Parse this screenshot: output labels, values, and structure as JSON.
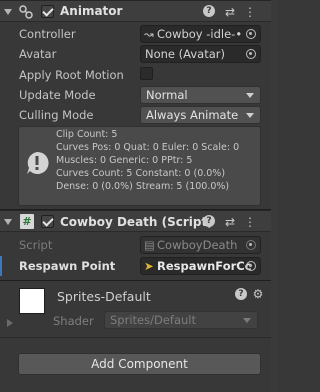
{
  "animator": {
    "title": "Animator",
    "enabled": true,
    "fields": {
      "controller_label": "Controller",
      "controller_value": "Cowboy -idle-•",
      "avatar_label": "Avatar",
      "avatar_value": "None (Avatar)",
      "apply_root_motion_label": "Apply Root Motion",
      "update_mode_label": "Update Mode",
      "update_mode_value": "Normal",
      "culling_mode_label": "Culling Mode",
      "culling_mode_value": "Always Animate"
    },
    "info": [
      "Clip Count: 5",
      "Curves Pos: 0 Quat: 0 Euler: 0 Scale: 0",
      "Muscles: 0 Generic: 0 PPtr: 5",
      "Curves Count: 5 Constant: 0 (0.0%)",
      "Dense: 0 (0.0%) Stream: 5 (100.0%)"
    ]
  },
  "script_component": {
    "title": "Cowboy Death (Script)",
    "enabled": true,
    "script_label": "Script",
    "script_value": "CowboyDeath",
    "respawn_label": "Respawn Point",
    "respawn_value": "RespawnForCc"
  },
  "material": {
    "name": "Sprites-Default",
    "shader_label": "Shader",
    "shader_value": "Sprites/Default"
  },
  "add_component_label": "Add Component",
  "icons": {
    "help": "help-icon",
    "presets": "presets-icon",
    "more": "more-vert-icon",
    "settings": "gear-icon",
    "target": "object-picker-icon"
  },
  "colors": {
    "background": "#383838",
    "info_icon": "#d4d4d4",
    "respawn_accent": "#3a79bb"
  }
}
